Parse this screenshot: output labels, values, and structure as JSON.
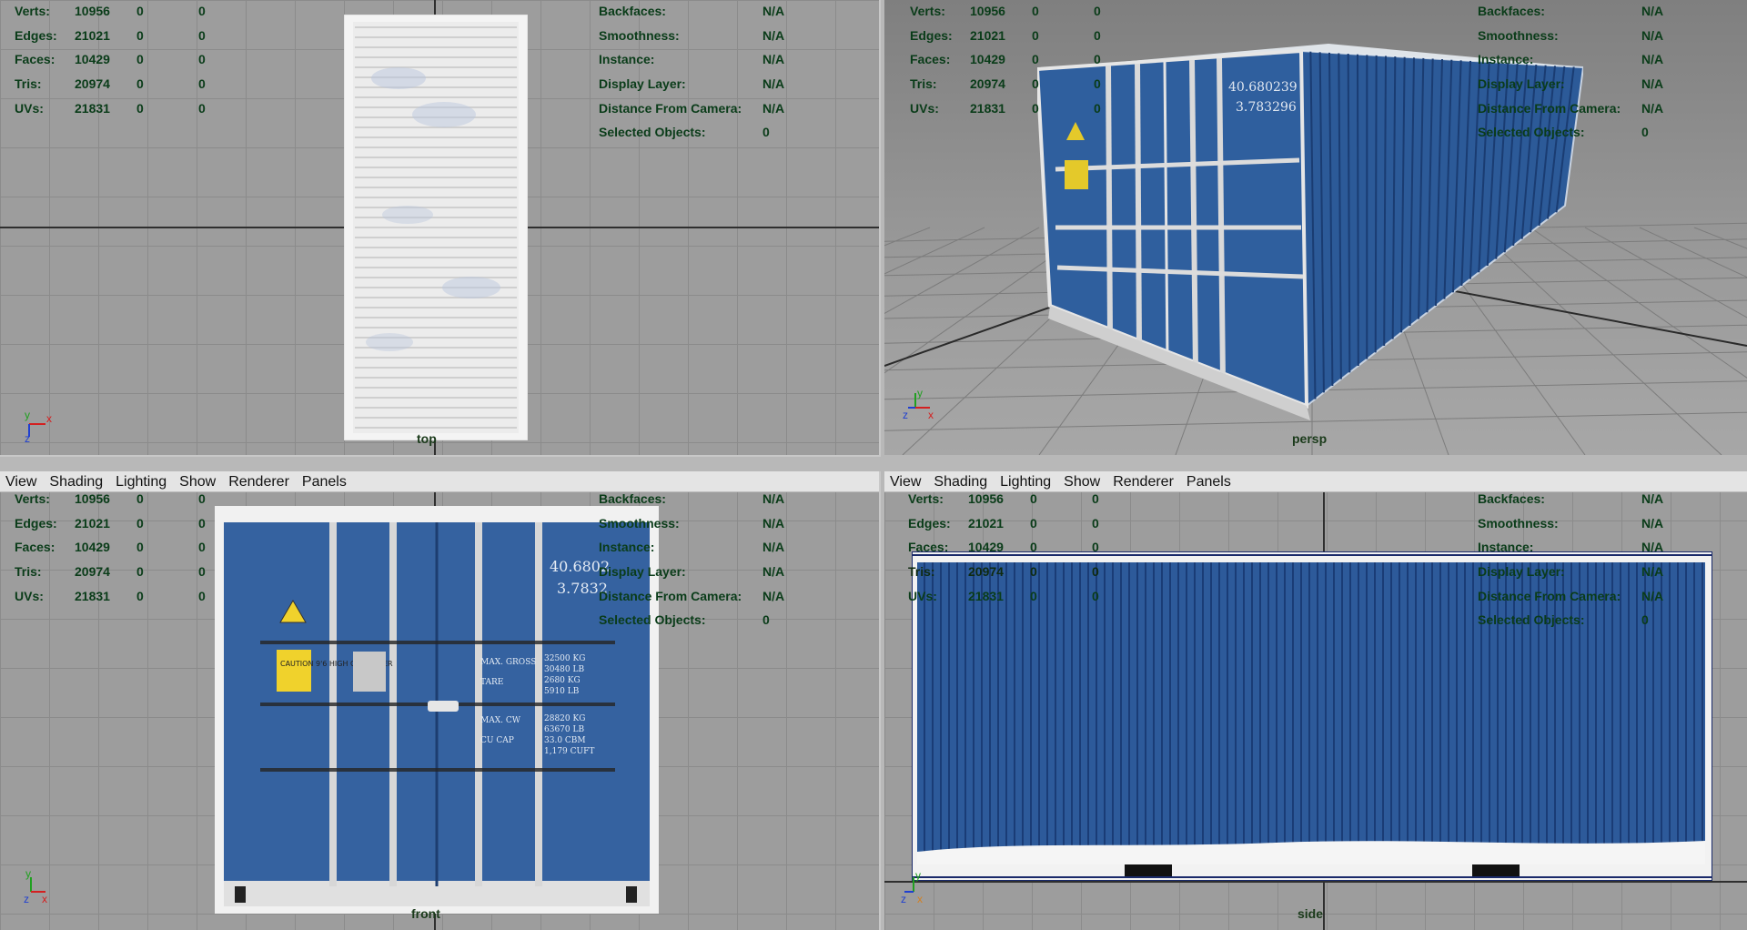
{
  "hud": {
    "stats": [
      {
        "label": "Verts:",
        "v1": "10956",
        "v2": "0",
        "v3": "0"
      },
      {
        "label": "Edges:",
        "v1": "21021",
        "v2": "0",
        "v3": "0"
      },
      {
        "label": "Faces:",
        "v1": "10429",
        "v2": "0",
        "v3": "0"
      },
      {
        "label": "Tris:",
        "v1": "20974",
        "v2": "0",
        "v3": "0"
      },
      {
        "label": "UVs:",
        "v1": "21831",
        "v2": "0",
        "v3": "0"
      }
    ],
    "info": [
      {
        "label": "Backfaces:",
        "value": "N/A"
      },
      {
        "label": "Smoothness:",
        "value": "N/A"
      },
      {
        "label": "Instance:",
        "value": "N/A"
      },
      {
        "label": "Display Layer:",
        "value": "N/A"
      },
      {
        "label": "Distance From Camera:",
        "value": "N/A"
      },
      {
        "label": "Selected Objects:",
        "value": "0"
      }
    ]
  },
  "menu": [
    "View",
    "Shading",
    "Lighting",
    "Show",
    "Renderer",
    "Panels"
  ],
  "viewports": {
    "top": {
      "camera": "top"
    },
    "persp": {
      "camera": "persp"
    },
    "front": {
      "camera": "front"
    },
    "side": {
      "camera": "side"
    }
  },
  "container_text": {
    "id_line1": "40.680239",
    "id_line2": "3.783296",
    "front_id1": "40.6802",
    "front_id2": "3.7832",
    "caution": "CAUTION 9'6 HIGH CONTAINER",
    "specs_labels": [
      "MAX. GROSS",
      "TARE",
      "MAX. CW",
      "CU CAP"
    ],
    "specs_values": [
      "32500 KG",
      "30480 LB",
      "2680 KG",
      "5910 LB",
      "28820 KG",
      "63670 LB",
      "33.0 CBM",
      "1,179 CUFT"
    ]
  },
  "axes": {
    "x": "x",
    "y": "y",
    "z": "z"
  },
  "colors": {
    "hud_text": "#0a3c19",
    "container_blue": "#2d5a9a",
    "viewport_bg": "#9d9d9d"
  }
}
